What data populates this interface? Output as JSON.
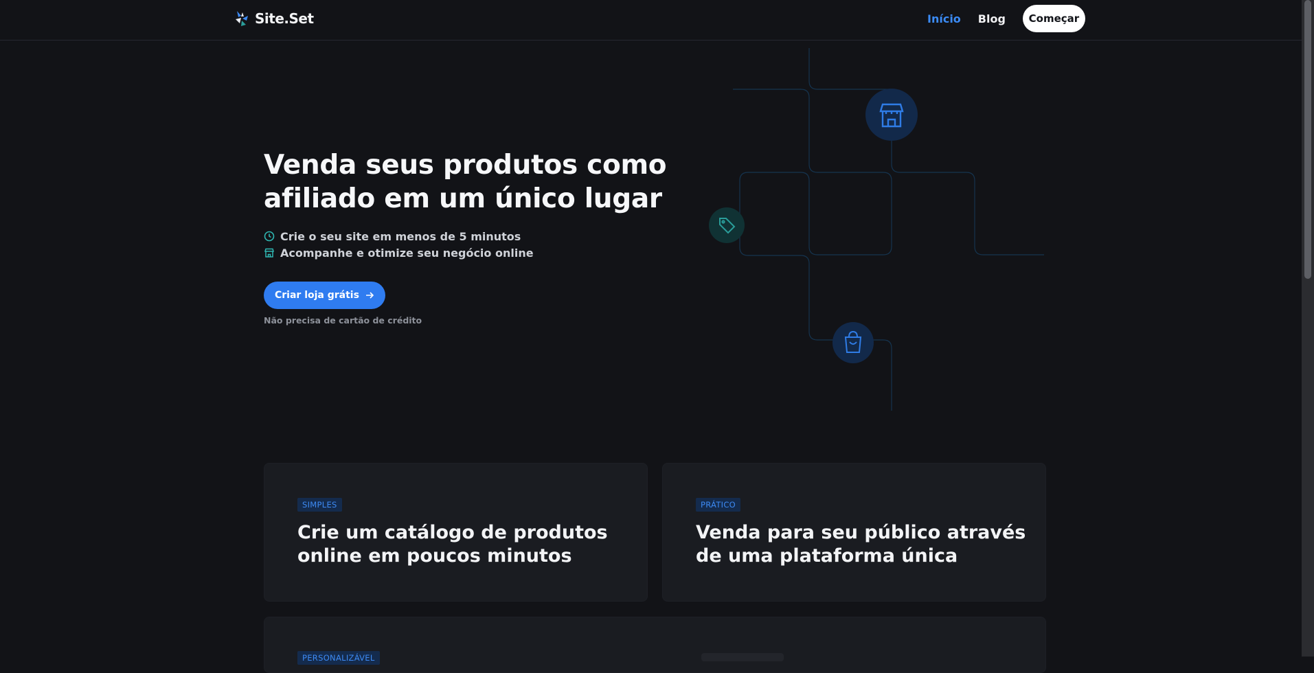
{
  "header": {
    "brand": "Site.Set",
    "nav": [
      {
        "label": "Início",
        "active": true
      },
      {
        "label": "Blog",
        "active": false
      }
    ],
    "start_label": "Começar"
  },
  "hero": {
    "title_line1": "Venda seus produtos como",
    "title_line2": "afiliado em um único lugar",
    "features": [
      {
        "icon": "clock-icon",
        "text": "Crie o seu site em menos de 5 minutos"
      },
      {
        "icon": "store-icon",
        "text": "Acompanhe e otimize seu negócio online"
      }
    ],
    "cta_label": "Criar loja grátis",
    "note": "Não precisa de cartão de crédito"
  },
  "cards": [
    {
      "tag": "SIMPLES",
      "title_line1": "Crie um catálogo de produtos",
      "title_line2": "online em poucos minutos"
    },
    {
      "tag": "PRÁTICO",
      "title_line1": "Venda para seu público através",
      "title_line2": "de uma plataforma única"
    },
    {
      "tag": "PERSONALIZÁVEL"
    }
  ],
  "colors": {
    "background": "#121317",
    "accent": "#2f7cf0",
    "card": "#1a1c21",
    "teal": "#2a9d9a"
  }
}
